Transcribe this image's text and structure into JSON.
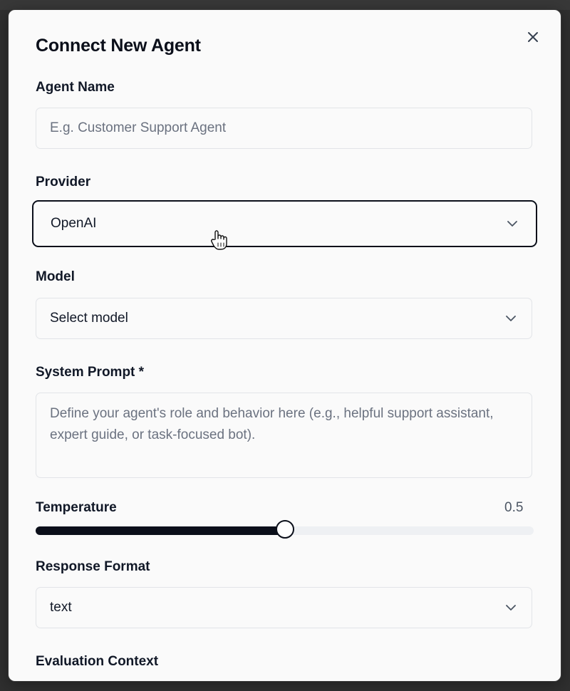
{
  "modal": {
    "title": "Connect New Agent",
    "close_icon": "close-icon"
  },
  "form": {
    "agent_name": {
      "label": "Agent Name",
      "placeholder": "E.g. Customer Support Agent",
      "value": ""
    },
    "provider": {
      "label": "Provider",
      "value": "OpenAI",
      "icon": "chevron-down-icon"
    },
    "model": {
      "label": "Model",
      "value": "Select model",
      "icon": "chevron-down-icon"
    },
    "system_prompt": {
      "label": "System Prompt *",
      "placeholder": "Define your agent's role and behavior here (e.g., helpful support assistant, expert guide, or task-focused bot).",
      "value": ""
    },
    "temperature": {
      "label": "Temperature",
      "value_text": "0.5",
      "value": 0.5,
      "min": 0,
      "max": 1
    },
    "response_format": {
      "label": "Response Format",
      "value": "text",
      "icon": "chevron-down-icon"
    },
    "evaluation_context": {
      "label": "Evaluation Context"
    }
  },
  "colors": {
    "accent": "#0b0f1a",
    "backdrop": "#2f2f2f",
    "modal_bg": "#fafafa",
    "border": "#e2e4e8",
    "placeholder": "#6b7280"
  }
}
